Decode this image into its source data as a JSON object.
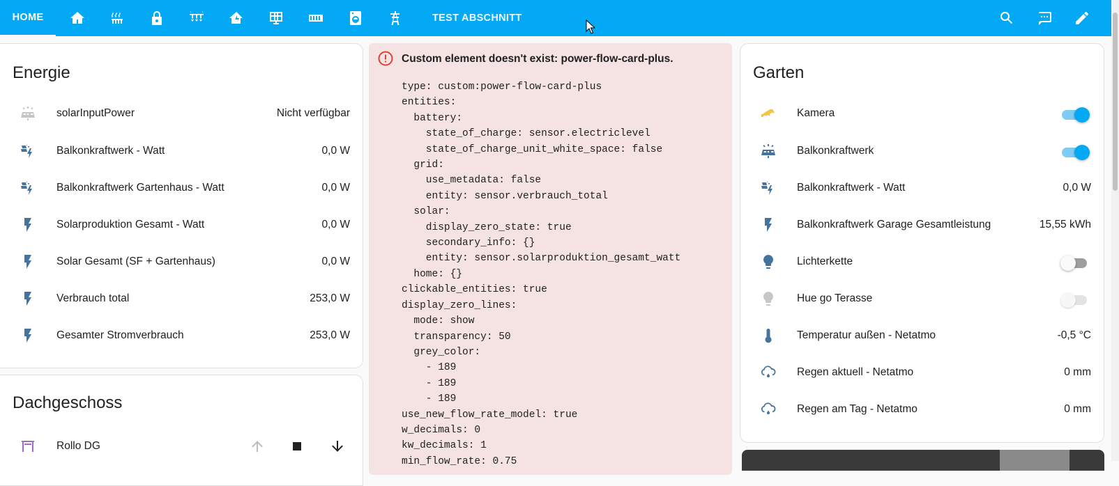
{
  "topbar": {
    "home_label": "HOME",
    "test_label": "TEST ABSCHNITT",
    "tab_icons": [
      "home-icon",
      "heating-icon",
      "lock-icon",
      "lights-icon",
      "home-lightning-icon",
      "solar-panel-icon",
      "radiator-icon",
      "washing-icon",
      "transmission-tower-icon"
    ],
    "actions": [
      "search-icon",
      "assist-icon",
      "edit-icon"
    ],
    "background": "#03a9f4"
  },
  "energie": {
    "title": "Energie",
    "rows": [
      {
        "icon": "solar-power-icon",
        "name": "solarInputPower",
        "value": "Nicht verfügbar"
      },
      {
        "icon": "solar-power-variant-icon",
        "name": "Balkonkraftwerk - Watt",
        "value": "0,0 W"
      },
      {
        "icon": "solar-power-variant-icon",
        "name": "Balkonkraftwerk Gartenhaus - Watt",
        "value": "0,0 W"
      },
      {
        "icon": "flash-icon",
        "name": "Solarproduktion Gesamt - Watt",
        "value": "0,0 W"
      },
      {
        "icon": "flash-icon",
        "name": "Solar Gesamt (SF + Gartenhaus)",
        "value": "0,0 W"
      },
      {
        "icon": "flash-icon",
        "name": "Verbrauch total",
        "value": "253,0 W"
      },
      {
        "icon": "flash-icon",
        "name": "Gesamter Stromverbrauch",
        "value": "253,0 W"
      }
    ]
  },
  "dachgeschoss": {
    "title": "Dachgeschoss",
    "rollo_name": "Rollo DG"
  },
  "error": {
    "title": "Custom element doesn't exist: power-flow-card-plus.",
    "code": "type: custom:power-flow-card-plus\nentities:\n  battery:\n    state_of_charge: sensor.electriclevel\n    state_of_charge_unit_white_space: false\n  grid:\n    use_metadata: false\n    entity: sensor.verbrauch_total\n  solar:\n    display_zero_state: true\n    secondary_info: {}\n    entity: sensor.solarproduktion_gesamt_watt\n  home: {}\nclickable_entities: true\ndisplay_zero_lines:\n  mode: show\n  transparency: 50\n  grey_color:\n    - 189\n    - 189\n    - 189\nuse_new_flow_rate_model: true\nw_decimals: 0\nkw_decimals: 1\nmin_flow_rate: 0.75"
  },
  "garten": {
    "title": "Garten",
    "rows": [
      {
        "icon": "cctv-icon",
        "name": "Kamera",
        "toggle": "on"
      },
      {
        "icon": "solar-power-icon",
        "name": "Balkonkraftwerk",
        "toggle": "on"
      },
      {
        "icon": "solar-power-variant-icon",
        "name": "Balkonkraftwerk - Watt",
        "value": "0,0 W"
      },
      {
        "icon": "flash-icon",
        "name": "Balkonkraftwerk Garage Gesamtleistung",
        "value": "15,55 kWh"
      },
      {
        "icon": "lightbulb-icon",
        "name": "Lichterkette",
        "toggle": "off"
      },
      {
        "icon": "lightbulb-icon",
        "name": "Hue go Terasse",
        "toggle": "disabled"
      },
      {
        "icon": "thermometer-icon",
        "name": "Temperatur außen - Netatmo",
        "value": "-0,5 °C"
      },
      {
        "icon": "weather-rainy-icon",
        "name": "Regen aktuell - Netatmo",
        "value": "0 mm"
      },
      {
        "icon": "weather-rainy-icon",
        "name": "Regen am Tag - Netatmo",
        "value": "0 mm"
      }
    ]
  },
  "colors": {
    "state_icon": "#44739e",
    "camera_icon": "#f6c343",
    "bulb_off": "#c7c7c7",
    "error_bg": "#f5e3e3",
    "error_icon": "#db4437",
    "rollo_icon": "#9c6ec7"
  }
}
